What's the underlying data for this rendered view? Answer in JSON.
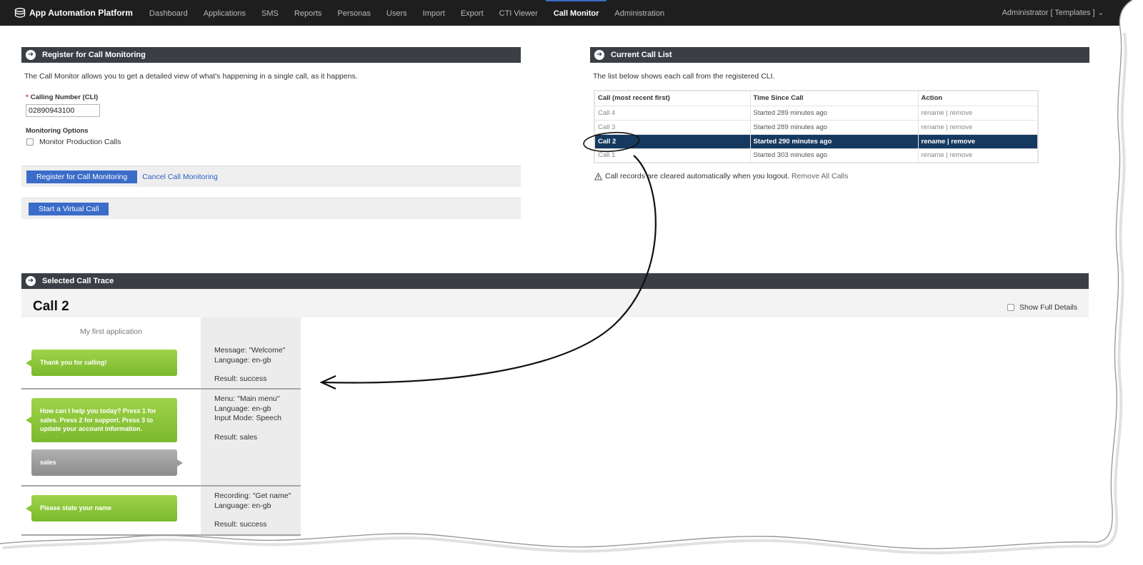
{
  "nav": {
    "brand": "App Automation Platform",
    "items": [
      {
        "label": "Dashboard",
        "active": false
      },
      {
        "label": "Applications",
        "active": false
      },
      {
        "label": "SMS",
        "active": false
      },
      {
        "label": "Reports",
        "active": false
      },
      {
        "label": "Personas",
        "active": false
      },
      {
        "label": "Users",
        "active": false
      },
      {
        "label": "Import",
        "active": false
      },
      {
        "label": "Export",
        "active": false
      },
      {
        "label": "CTI Viewer",
        "active": false
      },
      {
        "label": "Call Monitor",
        "active": true
      },
      {
        "label": "Administration",
        "active": false
      }
    ],
    "user": "Administrator [ Templates ]"
  },
  "register": {
    "title": "Register for Call Monitoring",
    "intro": "The Call Monitor allows you to get a detailed view of what's happening in a single call, as it happens.",
    "cli_required": "*",
    "cli_label": "Calling Number (CLI)",
    "cli_value": "02890943100",
    "options_label": "Monitoring Options",
    "monitor_production": "Monitor Production Calls",
    "register_button": "Register for Call Monitoring",
    "cancel_link": "Cancel Call Monitoring",
    "virtual_button": "Start a Virtual Call"
  },
  "call_list": {
    "title": "Current Call List",
    "intro": "The list below shows each call from the registered CLI.",
    "columns": [
      "Call (most recent first)",
      "Time Since Call",
      "Action"
    ],
    "rows": [
      {
        "call": "Call 4",
        "time": "Started 289 minutes ago",
        "rename": "rename",
        "sep": " | ",
        "remove": "remove",
        "selected": false
      },
      {
        "call": "Call 3",
        "time": "Started 289 minutes ago",
        "rename": "rename",
        "sep": " | ",
        "remove": "remove",
        "selected": false
      },
      {
        "call": "Call 2",
        "time": "Started 290 minutes ago",
        "rename": "rename",
        "sep": " | ",
        "remove": "remove",
        "selected": true
      },
      {
        "call": "Call 1",
        "time": "Started 303 minutes ago",
        "rename": "rename",
        "sep": " | ",
        "remove": "remove",
        "selected": false
      }
    ],
    "note": "Call records are cleared automatically when you logout.",
    "remove_all": "Remove All Calls"
  },
  "trace": {
    "title": "Selected Call Trace",
    "call_title": "Call 2",
    "show_full": "Show Full Details",
    "app_name": "My first application",
    "steps": [
      {
        "bubble": "Thank you for calling!",
        "lines": [
          "Message: \"Welcome\"",
          "Language: en-gb"
        ],
        "result": "Result: success"
      },
      {
        "bubble": "How can I help you today? Press 1 for sales. Press 2 for support. Press 3 to update your account information.",
        "reply": "sales",
        "lines": [
          "Menu: \"Main menu\"",
          "Language: en-gb",
          "Input Mode: Speech"
        ],
        "result": "Result: sales"
      },
      {
        "bubble": "Please state your name",
        "lines": [
          "Recording: \"Get name\"",
          "Language: en-gb"
        ],
        "result": "Result: success"
      }
    ]
  },
  "colors": {
    "nav_bg": "#1e1e1e",
    "section_header": "#3b3f45",
    "primary_button": "#3a6cc8",
    "selected_row": "#163a5f",
    "bubble_green": "#8cc43a"
  }
}
